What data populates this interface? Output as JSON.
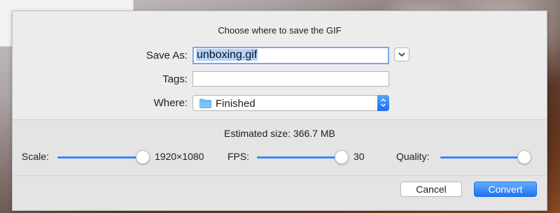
{
  "dialog": {
    "title": "Choose where to save the GIF",
    "save_as": {
      "label": "Save As:",
      "value": "unboxing.gif"
    },
    "tags": {
      "label": "Tags:",
      "value": ""
    },
    "where": {
      "label": "Where:",
      "value": "Finished"
    }
  },
  "options": {
    "estimated_size": "Estimated size: 366.7 MB",
    "scale": {
      "label": "Scale:",
      "value": "1920×1080",
      "level": 1.0
    },
    "fps": {
      "label": "FPS:",
      "value": "30",
      "level": 1.0
    },
    "quality": {
      "label": "Quality:",
      "level": 1.0
    }
  },
  "buttons": {
    "cancel": "Cancel",
    "convert": "Convert"
  },
  "colors": {
    "accent": "#3b87f5",
    "selection": "#b3d2fd"
  },
  "icons": {
    "disclosure": "chevron-down-icon",
    "folder": "folder-icon",
    "popup": "updown-chevron-icon"
  }
}
